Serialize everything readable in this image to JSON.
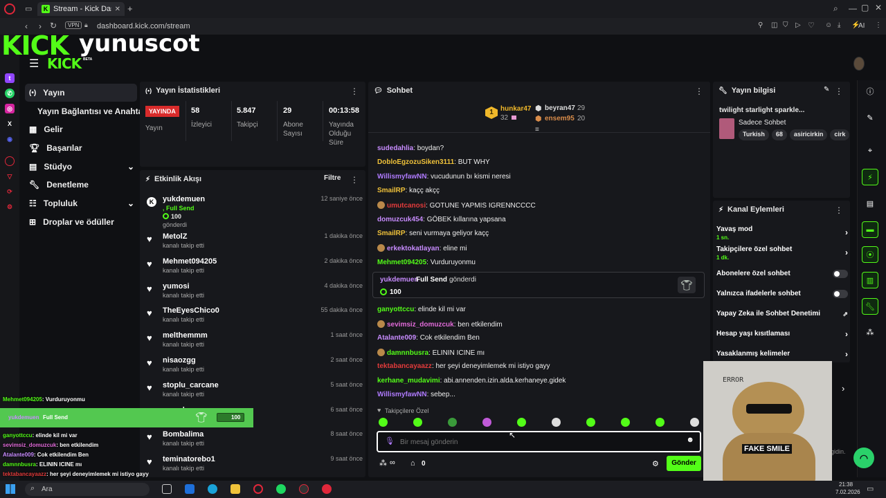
{
  "browser": {
    "tab_title": "Stream - Kick Dashboard",
    "vpn_label": "VPN",
    "url": "dashboard.kick.com/stream",
    "ai_label": "AI"
  },
  "header": {
    "logo_text": "KICK",
    "streamer_name": "yunuscot",
    "logo_sub": "KICK",
    "beta_label": "BETA"
  },
  "nav": {
    "items": [
      {
        "label": "Yayın",
        "icon": "broadcast-icon"
      },
      {
        "label": "Yayın Bağlantısı ve Anahtarı"
      },
      {
        "label": "Gelir",
        "icon": "chart-icon"
      },
      {
        "label": "Başarılar",
        "icon": "trophy-icon"
      },
      {
        "label": "Stüdyo",
        "icon": "studio-icon"
      },
      {
        "label": "Denetleme",
        "icon": "wrench-icon"
      },
      {
        "label": "Topluluk",
        "icon": "community-icon"
      },
      {
        "label": "Droplar ve ödüller",
        "icon": "drops-icon"
      }
    ]
  },
  "stats": {
    "title": "Yayın İstatistikleri",
    "live_badge": "YAYINDA",
    "status_label": "Yayın",
    "viewers": "58",
    "viewers_label": "İzleyici",
    "followers": "5.847",
    "followers_label": "Takipçi",
    "subs": "29",
    "subs_label": "Abone Sayısı",
    "uptime": "00:13:58",
    "uptime_label": "Yayında Olduğu Süre"
  },
  "activity": {
    "title": "Etkinlik Akışı",
    "filter_label": "Filtre",
    "events": [
      {
        "name": "yukdemuen",
        "highlight": ", Full Send",
        "amount": "100",
        "sub": "gönderdi",
        "time": "12 saniye önce"
      },
      {
        "name": "MetolZ",
        "sub": "kanalı takip etti",
        "time": "1 dakika önce"
      },
      {
        "name": "Mehmet094205",
        "sub": "kanalı takip etti",
        "time": "2 dakika önce"
      },
      {
        "name": "yumosi",
        "sub": "kanalı takip etti",
        "time": "4 dakika önce"
      },
      {
        "name": "TheEyesChico0",
        "sub": "kanalı takip etti",
        "time": "55 dakika önce"
      },
      {
        "name": "melthemmm",
        "sub": "kanalı takip etti",
        "time": "1 saat önce"
      },
      {
        "name": "nisaozgg",
        "sub": "kanalı takip etti",
        "time": "2 saat önce"
      },
      {
        "name": "stoplu_carcane",
        "sub": "kanalı takip etti",
        "time": "5 saat önce"
      },
      {
        "name": "ruzvela",
        "sub": "kanalı takip etti",
        "time": "6 saat önce"
      },
      {
        "name": "Bombalima",
        "sub": "kanalı takip etti",
        "time": "8 saat önce"
      },
      {
        "name": "teminatorebo1",
        "sub": "kanalı takip etti",
        "time": "9 saat önce"
      }
    ]
  },
  "chat": {
    "title": "Sohbet",
    "leaders": [
      {
        "rank": "1",
        "name": "hunkar47",
        "score": "32"
      },
      {
        "name": "beyran47",
        "score": "29"
      },
      {
        "name": "ensem95",
        "score": "20"
      }
    ],
    "messages": [
      {
        "user": "sudedahlia",
        "text": ": boydan?",
        "color": "#c88cff"
      },
      {
        "user": "DobloEgzozuSiken3111",
        "text": ": BUT WHY",
        "color": "#f0c23a"
      },
      {
        "user": "WillismyfawNN",
        "text": ": vucudunun bı kismi neresi",
        "color": "#b07bff"
      },
      {
        "user": "SmailRP",
        "text": ": kaçç akçç",
        "color": "#f0c23a"
      },
      {
        "user": "umutcanosi",
        "text": ": GOTUNE YAPMIS IGRENNCCCC",
        "color": "#e23b3b"
      },
      {
        "user": "domuzcuk454",
        "text": ": GÖBEK kıllarına yapsana",
        "color": "#c88cff"
      },
      {
        "user": "SmailRP",
        "text": ": seni vurmaya geliyor kaçç",
        "color": "#f0c23a"
      },
      {
        "user": "erkektokatlayan",
        "text": ": eline mi",
        "color": "#c88cff"
      },
      {
        "user": "Mehmet094205",
        "text": ": Vurduruyonmu",
        "color": "#53fc18"
      },
      {
        "user": "ganyottccu",
        "text": ": elinde kil mi var",
        "color": "#53fc18"
      },
      {
        "user": "sevimsiz_domuzcuk",
        "text": ": ben etkilendim",
        "color": "#e06ad8"
      },
      {
        "user": "Atalante009",
        "text": ": Cok etkilendim Ben",
        "color": "#c88cff"
      },
      {
        "user": "damnnbusra",
        "text": ": ELININ ICINE mı",
        "color": "#53fc18"
      },
      {
        "user": "tektabancayaazz",
        "text": ": her şeyi deneyimlemek mi istiyo gayy",
        "color": "#e23b3b"
      },
      {
        "user": "kerhane_mudavimi",
        "text": ": abi.annenden.izin.alda.kerhaneye.gidek",
        "color": "#53fc18"
      },
      {
        "user": "WillismyfawNN",
        "text": ": sebep...",
        "color": "#b07bff"
      }
    ],
    "gift": {
      "user": "yukdemuen",
      "action": "Full Send",
      "suffix": "gönderdi",
      "amount": "100"
    },
    "followers_only": "Takipçilere Özel",
    "input_placeholder": "Bir mesaj gönderin",
    "points": "0",
    "send_label": "Gönder"
  },
  "stream_info": {
    "title": "Yayın bilgisi",
    "stream_title": "twilight starlight sparkle...",
    "category": "Sadece Sohbet",
    "tags": [
      "Turkish",
      "68",
      "asiricirkin",
      "cirk"
    ]
  },
  "channel_actions": {
    "title": "Kanal Eylemleri",
    "slow_mode": "Yavaş mod",
    "slow_value": "1 sn.",
    "followers_chat": "Takipçilere özel sohbet",
    "followers_value": "1 dk.",
    "subs_chat": "Abonelere özel sohbet",
    "emote_chat": "Yalnızca ifadelerle sohbet",
    "ai_mod": "Yapay Zeka ile Sohbet Denetimi",
    "age_limit": "Hesap yaşı kısıtlaması",
    "banned_words": "Yasaklanmış kelimeler"
  },
  "overlay": {
    "lines": [
      {
        "user": "Mehmet094205",
        "text": ": Vurduruyonmu",
        "color": "#53fc18"
      },
      {
        "user": "ganyottccu",
        "text": ": elinde kil mi var",
        "color": "#53fc18"
      },
      {
        "user": "sevimsiz_domuzcuk",
        "text": ": ben etkilendim",
        "color": "#e06ad8"
      },
      {
        "user": "Atalante009",
        "text": ": Cok etkilendim Ben",
        "color": "#c88cff"
      },
      {
        "user": "damnnbusra",
        "text": ": ELININ ICINE mı",
        "color": "#53fc18"
      },
      {
        "user": "tektabancayaazz",
        "text": ": her şeyi deneyimlemek mi istiyo gayy",
        "color": "#e23b3b"
      }
    ],
    "gift_user": "yukdemuen",
    "gift_text": "Full Send",
    "gift_amount": "100",
    "bear_caption": "FAKE SMILE",
    "bear_error": "ERROR"
  },
  "taskbar": {
    "search": "Ara",
    "time": "21:38",
    "date": "7.02.2026"
  },
  "partial_text": "gidin."
}
